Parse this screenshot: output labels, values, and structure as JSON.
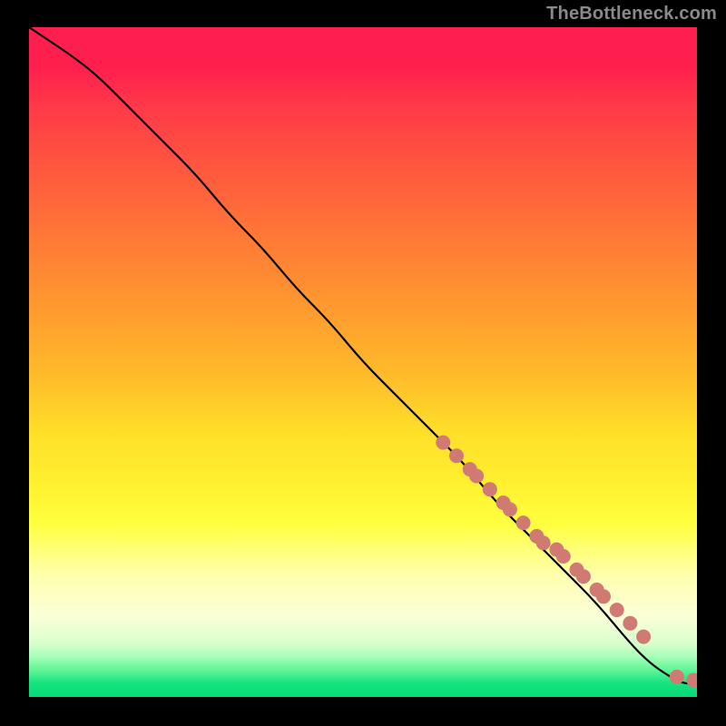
{
  "attribution": "TheBottleneck.com",
  "chart_data": {
    "type": "line",
    "title": "",
    "xlabel": "",
    "ylabel": "",
    "xlim": [
      0,
      100
    ],
    "ylim": [
      0,
      100
    ],
    "grid": false,
    "legend": false,
    "series": [
      {
        "name": "curve",
        "type": "line",
        "color": "#000000",
        "x": [
          0,
          3,
          6,
          10,
          15,
          20,
          25,
          30,
          35,
          40,
          45,
          50,
          55,
          60,
          65,
          70,
          75,
          80,
          85,
          90,
          93,
          96,
          98,
          100
        ],
        "y": [
          100,
          98,
          96,
          93,
          88,
          83,
          78,
          72,
          67,
          61,
          56,
          50,
          45,
          40,
          35,
          29,
          24,
          19,
          14,
          8,
          5,
          3,
          2,
          2
        ]
      },
      {
        "name": "marker-cluster",
        "type": "scatter",
        "color": "#d17a74",
        "marker_radius": 8,
        "x": [
          62,
          64,
          66,
          67,
          69,
          71,
          72,
          74,
          76,
          77,
          79,
          80,
          82,
          83,
          85,
          86,
          88,
          90,
          92,
          97,
          99.5
        ],
        "y": [
          38,
          36,
          34,
          33,
          31,
          29,
          28,
          26,
          24,
          23,
          22,
          21,
          19,
          18,
          16,
          15,
          13,
          11,
          9,
          3,
          2.5
        ]
      }
    ],
    "background_gradient_stops": [
      {
        "pos": 0.0,
        "color": "#ff1f4f"
      },
      {
        "pos": 0.22,
        "color": "#ff5a3e"
      },
      {
        "pos": 0.42,
        "color": "#ff9a2f"
      },
      {
        "pos": 0.6,
        "color": "#ffdd2a"
      },
      {
        "pos": 0.74,
        "color": "#ffff3e"
      },
      {
        "pos": 0.88,
        "color": "#fbffd8"
      },
      {
        "pos": 0.96,
        "color": "#5ef596"
      },
      {
        "pos": 1.0,
        "color": "#05db78"
      }
    ]
  }
}
